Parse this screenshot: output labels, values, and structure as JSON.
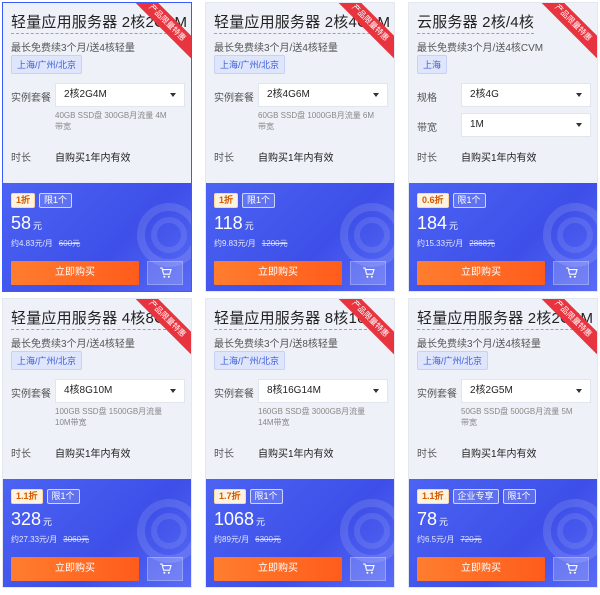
{
  "cards": [
    {
      "title": "轻量应用服务器 2核2G4M",
      "subtitle": "最长免费续3个月/送4核轻量",
      "region": "上海/广州/北京",
      "ribbon": "产品限量特惠",
      "rows": [
        {
          "label": "实例套餐",
          "select": "2核2G4M",
          "spec": "40GB SSD盘 300GB月流量 4M带宽"
        }
      ],
      "duration_label": "时长",
      "duration": "自购买1年内有效",
      "badges": [
        {
          "type": "discount",
          "text": "1折"
        },
        {
          "type": "limit",
          "text": "限1个"
        }
      ],
      "price": "58",
      "unit": "元",
      "monthly": "约4.83元/月",
      "original": "600元",
      "buy_label": "立即购买"
    },
    {
      "title": "轻量应用服务器 2核4G6M",
      "subtitle": "最长免费续3个月/送4核轻量",
      "region": "上海/广州/北京",
      "ribbon": "产品限量特惠",
      "rows": [
        {
          "label": "实例套餐",
          "select": "2核4G6M",
          "spec": "60GB SSD盘 1000GB月流量 6M带宽"
        }
      ],
      "duration_label": "时长",
      "duration": "自购买1年内有效",
      "badges": [
        {
          "type": "discount",
          "text": "1折"
        },
        {
          "type": "limit",
          "text": "限1个"
        }
      ],
      "price": "118",
      "unit": "元",
      "monthly": "约9.83元/月",
      "original": "1200元",
      "buy_label": "立即购买"
    },
    {
      "title": "云服务器 2核/4核",
      "subtitle": "最长免费续3个月/送4核CVM",
      "region": "上海",
      "ribbon": "产品限量特惠",
      "rows": [
        {
          "label": "规格",
          "select": "2核4G",
          "spec": ""
        },
        {
          "label": "带宽",
          "select": "1M",
          "spec": ""
        }
      ],
      "duration_label": "时长",
      "duration": "自购买1年内有效",
      "badges": [
        {
          "type": "discount",
          "text": "0.6折"
        },
        {
          "type": "limit",
          "text": "限1个"
        }
      ],
      "price": "184",
      "unit": "元",
      "monthly": "约15.33元/月",
      "original": "2868元",
      "buy_label": "立即购买"
    },
    {
      "title": "轻量应用服务器 4核8G",
      "subtitle": "最长免费续3个月/送4核轻量",
      "region": "上海/广州/北京",
      "ribbon": "产品限量特惠",
      "rows": [
        {
          "label": "实例套餐",
          "select": "4核8G10M",
          "spec": "100GB SSD盘 1500GB月流量 10M带宽"
        }
      ],
      "duration_label": "时长",
      "duration": "自购买1年内有效",
      "badges": [
        {
          "type": "discount",
          "text": "1.1折"
        },
        {
          "type": "limit",
          "text": "限1个"
        }
      ],
      "price": "328",
      "unit": "元",
      "monthly": "约27.33元/月",
      "original": "3060元",
      "buy_label": "立即购买"
    },
    {
      "title": "轻量应用服务器 8核16G",
      "subtitle": "最长免费续3个月/送8核轻量",
      "region": "上海/广州/北京",
      "ribbon": "产品限量特惠",
      "rows": [
        {
          "label": "实例套餐",
          "select": "8核16G14M",
          "spec": "160GB SSD盘 3000GB月流量 14M带宽"
        }
      ],
      "duration_label": "时长",
      "duration": "自购买1年内有效",
      "badges": [
        {
          "type": "discount",
          "text": "1.7折"
        },
        {
          "type": "limit",
          "text": "限1个"
        }
      ],
      "price": "1068",
      "unit": "元",
      "monthly": "约89元/月",
      "original": "6300元",
      "buy_label": "立即购买"
    },
    {
      "title": "轻量应用服务器 2核2G5M",
      "subtitle": "最长免费续3个月/送4核轻量",
      "region": "上海/广州/北京",
      "ribbon": "产品限量特惠",
      "rows": [
        {
          "label": "实例套餐",
          "select": "2核2G5M",
          "spec": "50GB SSD盘 500GB月流量 5M带宽"
        }
      ],
      "duration_label": "时长",
      "duration": "自购买1年内有效",
      "badges": [
        {
          "type": "discount",
          "text": "1.1折"
        },
        {
          "type": "limit",
          "text": "企业专享"
        },
        {
          "type": "limit",
          "text": "限1个"
        }
      ],
      "price": "78",
      "unit": "元",
      "monthly": "约6.5元/月",
      "original": "720元",
      "buy_label": "立即购买"
    }
  ],
  "icons": {
    "cart": "shopping-cart-icon",
    "dropdown": "chevron-down-icon"
  },
  "colors": {
    "accent": "#3d4fe8",
    "buy": "#ff6a22",
    "ribbon": "#e8343f",
    "region": "#3a5bd9"
  }
}
